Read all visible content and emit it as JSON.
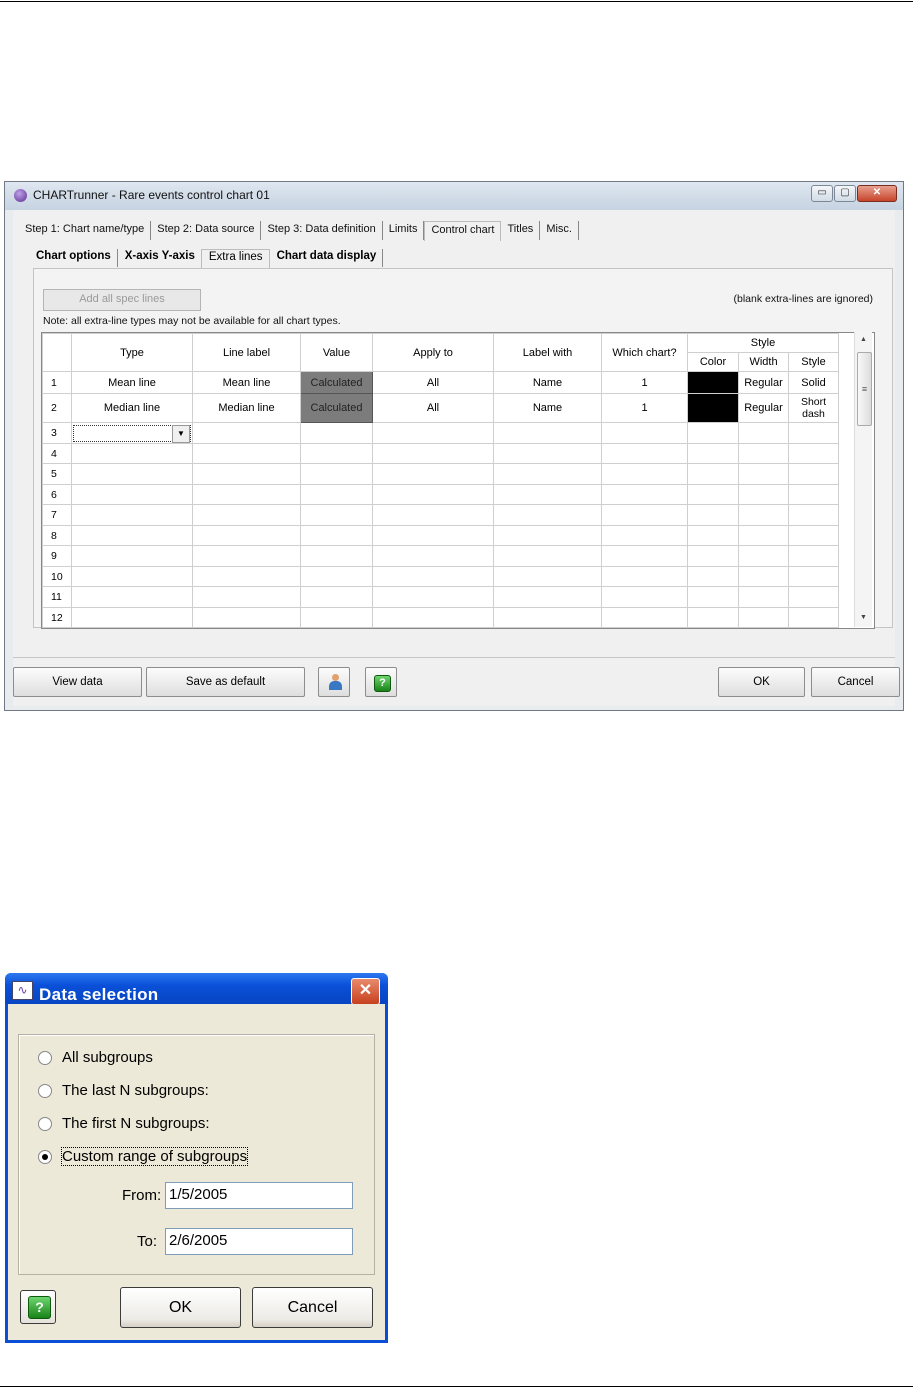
{
  "window": {
    "title": "CHARTrunner - Rare events control chart 01",
    "controls": {
      "minimize": "▭",
      "maximize": "▢",
      "close": "✕"
    },
    "tabs_top": [
      "Step 1: Chart name/type",
      "Step 2: Data source",
      "Step 3: Data definition",
      "Limits",
      "Control chart",
      "Titles",
      "Misc."
    ],
    "tabs_sub": [
      "Chart options",
      "X-axis Y-axis",
      "Extra lines",
      "Chart data display"
    ],
    "add_spec_button": "Add all spec lines",
    "blank_note": "(blank extra-lines are ignored)",
    "note": "Note: all extra-line types may not be available for all chart types.",
    "grid": {
      "headers": {
        "type": "Type",
        "line_label": "Line label",
        "value": "Value",
        "apply_to": "Apply to",
        "label_with": "Label with",
        "which_chart": "Which chart?",
        "style_group": "Style",
        "color": "Color",
        "width": "Width",
        "style": "Style"
      },
      "rows": [
        {
          "n": "1",
          "type": "Mean line",
          "line_label": "Mean line",
          "value": "Calculated",
          "apply_to": "All",
          "label_with": "Name",
          "which_chart": "1",
          "color": "#000000",
          "width": "Regular",
          "style": "Solid"
        },
        {
          "n": "2",
          "type": "Median line",
          "line_label": "Median line",
          "value": "Calculated",
          "apply_to": "All",
          "label_with": "Name",
          "which_chart": "1",
          "color": "#000000",
          "width": "Regular",
          "style": "Short dash"
        }
      ],
      "empty_rows": [
        "3",
        "4",
        "5",
        "6",
        "7",
        "8",
        "9",
        "10",
        "11",
        "12"
      ]
    },
    "buttons": {
      "view_data": "View data",
      "save_default": "Save as default",
      "ok": "OK",
      "cancel": "Cancel"
    }
  },
  "dialog": {
    "title": "Data selection",
    "options": [
      "All subgroups",
      "The last N subgroups:",
      "The first N subgroups:",
      "Custom range of subgroups"
    ],
    "selected": "Custom range of subgroups",
    "from_label": "From:",
    "from_value": "1/5/2005",
    "to_label": "To:",
    "to_value": "2/6/2005",
    "ok": "OK",
    "cancel": "Cancel"
  }
}
